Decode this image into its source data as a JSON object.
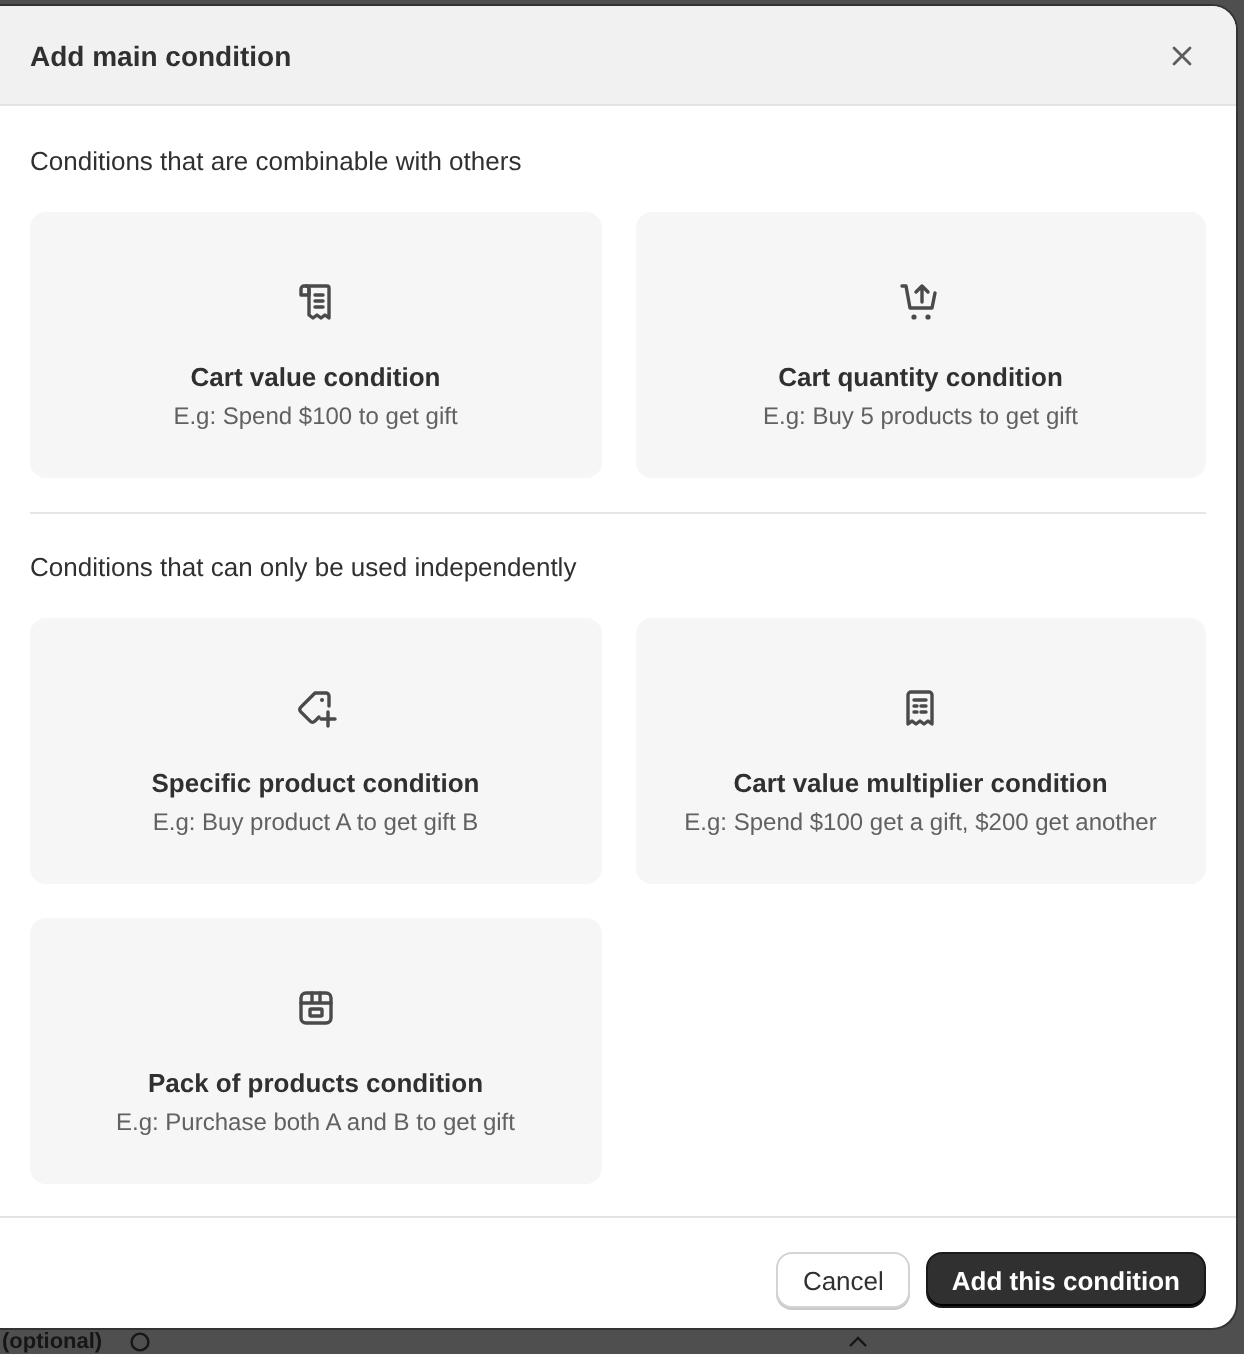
{
  "dialog": {
    "title": "Add main condition"
  },
  "sections": [
    {
      "label": "Conditions that are combinable with others",
      "options": [
        {
          "kind": "value",
          "title": "Cart value condition",
          "description": "E.g: Spend $100 to get gift"
        },
        {
          "kind": "quantity",
          "title": "Cart quantity condition",
          "description": "E.g: Buy 5 products to get gift"
        }
      ]
    },
    {
      "label": "Conditions that can only be used independently",
      "options": [
        {
          "kind": "product",
          "title": "Specific product condition",
          "description": "E.g: Buy product A to get gift B"
        },
        {
          "kind": "multiplier",
          "title": "Cart value multiplier condition",
          "description": "E.g: Spend $100 get a gift, $200 get another"
        },
        {
          "kind": "pack",
          "title": "Pack of products condition",
          "description": "E.g: Purchase both A and B to get gift"
        }
      ]
    }
  ],
  "footer": {
    "buttons": [
      {
        "label": "Cancel",
        "kind": "secondary"
      },
      {
        "label": "Add this condition",
        "kind": "primary"
      }
    ]
  },
  "background": {
    "label": "(optional)"
  }
}
